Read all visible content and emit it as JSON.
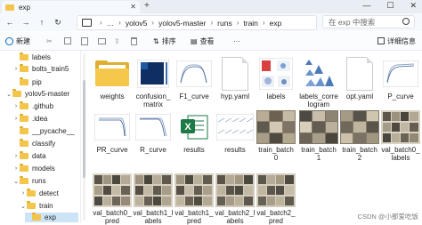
{
  "window": {
    "tab_title": "exp",
    "tab_close": "✕",
    "tab_add": "+",
    "minimize": "—",
    "maximize": "☐",
    "close": "✕"
  },
  "nav": {
    "back": "←",
    "forward": "→",
    "up": "↑",
    "refresh": "↻",
    "more": "…",
    "breadcrumb": [
      "yolov5",
      "yolov5-master",
      "runs",
      "train",
      "exp"
    ],
    "breadcrumb_sep": "›",
    "search_placeholder": "在 exp 中搜索"
  },
  "toolbar": {
    "new_label": "新建",
    "sort_label": "排序",
    "view_label": "查看",
    "more": "···",
    "details_label": "详细信息"
  },
  "sidebar": {
    "items": [
      {
        "label": "labels",
        "chevron": "",
        "icon": "folder-icon"
      },
      {
        "label": "bolts_train5",
        "chevron": "›",
        "icon": "folder-icon"
      },
      {
        "label": "pip",
        "chevron": "",
        "icon": "folder-icon"
      },
      {
        "label": "yolov5-master",
        "chevron": "⌄",
        "icon": "folder-icon"
      },
      {
        "label": ".github",
        "chevron": "›",
        "icon": "folder-icon"
      },
      {
        "label": ".idea",
        "chevron": "›",
        "icon": "folder-icon"
      },
      {
        "label": "__pycache__",
        "chevron": "",
        "icon": "folder-icon"
      },
      {
        "label": "classify",
        "chevron": "",
        "icon": "folder-icon"
      },
      {
        "label": "data",
        "chevron": "›",
        "icon": "folder-icon"
      },
      {
        "label": "models",
        "chevron": "›",
        "icon": "folder-icon"
      },
      {
        "label": "runs",
        "chevron": "⌄",
        "icon": "folder-icon"
      },
      {
        "label": "detect",
        "chevron": "›",
        "icon": "folder-icon"
      },
      {
        "label": "train",
        "chevron": "⌄",
        "icon": "folder-icon"
      },
      {
        "label": "exp",
        "chevron": "",
        "icon": "folder-icon",
        "selected": true
      }
    ]
  },
  "files": [
    {
      "name": "weights",
      "kind": "folder"
    },
    {
      "name": "confusion_\nmatrix",
      "kind": "matrix"
    },
    {
      "name": "F1_curve",
      "kind": "curve"
    },
    {
      "name": "hyp.yaml",
      "kind": "doc"
    },
    {
      "name": "labels",
      "kind": "labels"
    },
    {
      "name": "labels_corre\nlogram",
      "kind": "correlogram"
    },
    {
      "name": "opt.yaml",
      "kind": "doc"
    },
    {
      "name": "P_curve",
      "kind": "curve"
    },
    {
      "name": "PR_curve",
      "kind": "curve"
    },
    {
      "name": "R_curve",
      "kind": "curve"
    },
    {
      "name": "results",
      "kind": "excel"
    },
    {
      "name": "results",
      "kind": "results"
    },
    {
      "name": "train_batch\n0",
      "kind": "photo"
    },
    {
      "name": "train_batch\n1",
      "kind": "photo"
    },
    {
      "name": "train_batch\n2",
      "kind": "photo"
    },
    {
      "name": "val_batch0_\nlabels",
      "kind": "photo"
    },
    {
      "name": "val_batch0_\npred",
      "kind": "photo"
    },
    {
      "name": "val_batch1_l\nabels",
      "kind": "photo"
    },
    {
      "name": "val_batch1_\npred",
      "kind": "photo"
    },
    {
      "name": "val_batch2_l\nabels",
      "kind": "photo"
    },
    {
      "name": "val_batch2_\npred",
      "kind": "photo"
    }
  ],
  "watermark": "CSDN @小那爱吃饭",
  "colors": {
    "folder": "#f5c84c",
    "selected": "#cde4f7",
    "excel": "#1d7a45",
    "accent": "#0067c0"
  }
}
